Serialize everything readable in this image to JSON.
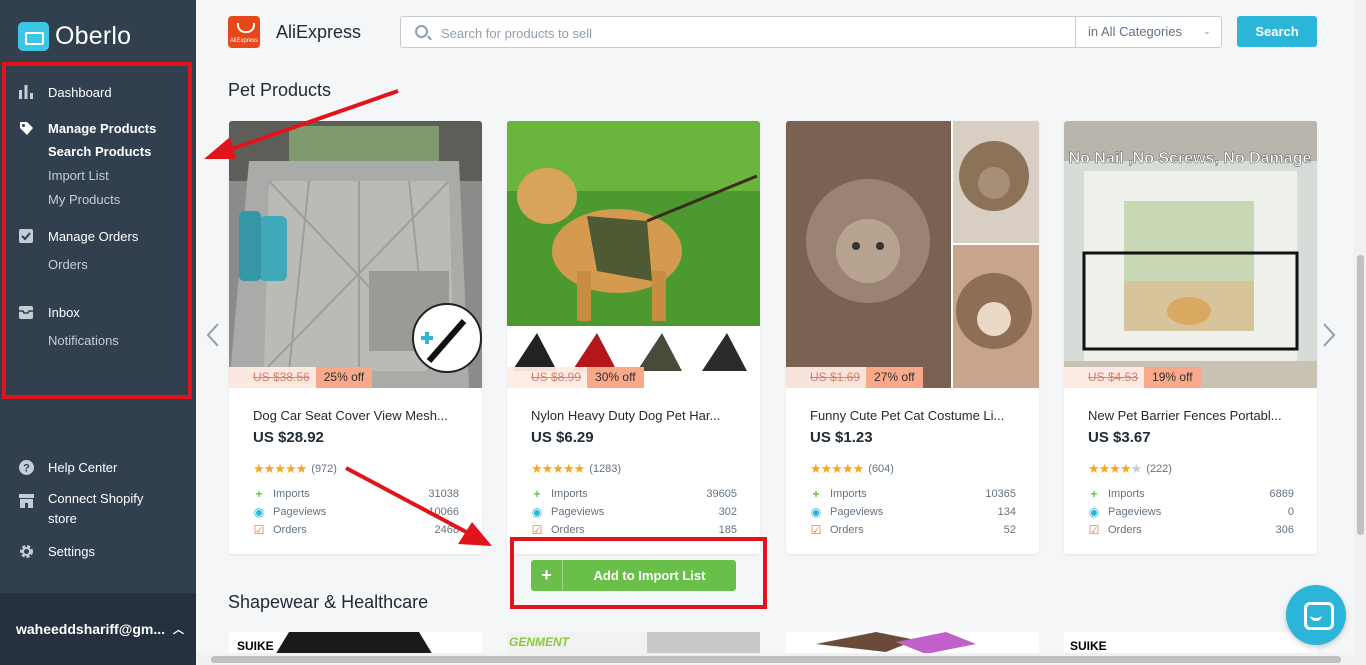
{
  "sidebar": {
    "logo_text": "Oberlo",
    "sections": [
      {
        "label": "Dashboard",
        "icon": "bar-chart-icon",
        "subitems": []
      },
      {
        "label": "Manage Products",
        "icon": "tag-icon",
        "subitems": [
          "Search Products",
          "Import List",
          "My Products"
        ]
      },
      {
        "label": "Manage Orders",
        "icon": "checkbox-icon",
        "subitems": [
          "Orders"
        ]
      },
      {
        "label": "Inbox",
        "icon": "inbox-icon",
        "subitems": [
          "Notifications"
        ]
      }
    ],
    "active_subitem": "Search Products",
    "bottom": [
      {
        "label": "Help Center",
        "icon": "help-icon"
      },
      {
        "label": "Connect Shopify store",
        "icon": "store-icon"
      },
      {
        "label": "Settings",
        "icon": "gear-icon"
      }
    ],
    "user": "waheeddshariff@gm..."
  },
  "topbar": {
    "source_name": "AliExpress",
    "source_logo_text": "AliExpress",
    "search_placeholder": "Search for products to sell",
    "category": "in All Categories",
    "search_button": "Search"
  },
  "sections": {
    "pet": "Pet Products",
    "shapewear": "Shapewear & Healthcare"
  },
  "products": [
    {
      "title": "Dog Car Seat Cover View Mesh...",
      "price": "US $28.92",
      "old_price": "US $38.56",
      "discount": "25% off",
      "stars": 5,
      "reviews": "(972)",
      "imports": "31038",
      "pageviews": "10066",
      "orders": "2468"
    },
    {
      "title": "Nylon Heavy Duty Dog Pet Har...",
      "price": "US $6.29",
      "old_price": "US $8.99",
      "discount": "30% off",
      "stars": 5,
      "reviews": "(1283)",
      "imports": "39605",
      "pageviews": "302",
      "orders": "185"
    },
    {
      "title": "Funny Cute Pet Cat Costume Li...",
      "price": "US $1.23",
      "old_price": "US $1.69",
      "discount": "27% off",
      "stars": 5,
      "reviews": "(604)",
      "imports": "10365",
      "pageviews": "134",
      "orders": "52"
    },
    {
      "title": "New Pet Barrier Fences Portabl...",
      "price": "US $3.67",
      "old_price": "US $4.53",
      "discount": "19% off",
      "stars": 4,
      "reviews": "(222)",
      "imports": "6869",
      "pageviews": "0",
      "orders": "306"
    }
  ],
  "stat_labels": {
    "imports": "Imports",
    "pageviews": "Pageviews",
    "orders": "Orders"
  },
  "add_button": "Add to Import List",
  "product4_banner": "No Nail ,No Screws, No Damage",
  "thumb_brands": [
    "SUIKE",
    "GENMENT",
    "",
    "SUIKE"
  ],
  "colors": {
    "sidebar_bg": "#313f4f",
    "accent": "#2bb5d8",
    "add_green": "#6abf4b",
    "annotation_red": "#e2141b"
  }
}
